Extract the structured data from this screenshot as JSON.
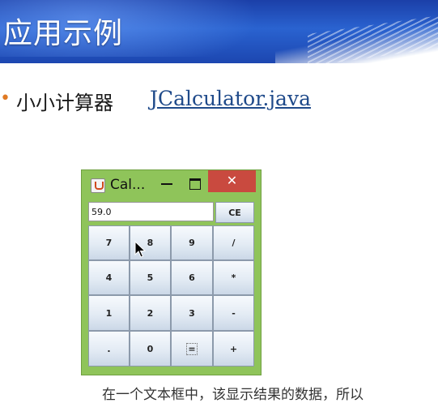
{
  "slide": {
    "title": "应用示例",
    "bullet_text": "小小计算器",
    "bullet_link": "JCalculator.java",
    "bottom_text": "在一个文本框中，该显示结果的数据，所以"
  },
  "window": {
    "title": "Cal...",
    "minimize_glyph": "—",
    "close_glyph": "✕",
    "display_value": "59.0",
    "ce_label": "CE",
    "keys": [
      [
        "7",
        "8",
        "9",
        "/"
      ],
      [
        "4",
        "5",
        "6",
        "*"
      ],
      [
        "1",
        "2",
        "3",
        "-"
      ],
      [
        ".",
        "0",
        "=",
        "+"
      ]
    ]
  },
  "colors": {
    "window_frame": "#8fc45a",
    "close_button": "#c94a3f",
    "banner": "#2a63d0",
    "bullet_dot": "#e07a24"
  },
  "icons": [
    "java-app-icon",
    "minimize-icon",
    "maximize-icon",
    "close-icon",
    "mouse-cursor-icon"
  ]
}
